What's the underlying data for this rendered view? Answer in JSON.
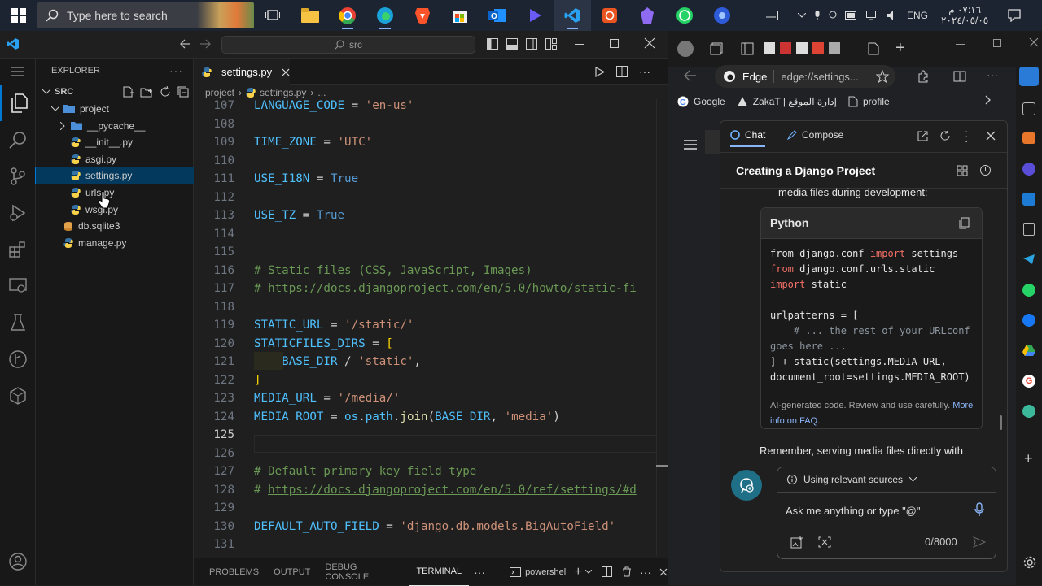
{
  "taskbar": {
    "search_placeholder": "Type here to search",
    "language": "ENG",
    "time": "٠٧:١٦ م",
    "date": "٢٠٢٤/٠٥/٠٥"
  },
  "vscode": {
    "command_center": "src",
    "explorer": {
      "title": "EXPLORER",
      "root": "SRC",
      "items": [
        {
          "label": "project",
          "kind": "folder-open"
        },
        {
          "label": "__pycache__",
          "kind": "folder"
        },
        {
          "label": "__init__.py",
          "kind": "py"
        },
        {
          "label": "asgi.py",
          "kind": "py"
        },
        {
          "label": "settings.py",
          "kind": "py"
        },
        {
          "label": "urls.py",
          "kind": "py"
        },
        {
          "label": "wsgi.py",
          "kind": "py"
        },
        {
          "label": "db.sqlite3",
          "kind": "db"
        },
        {
          "label": "manage.py",
          "kind": "py"
        }
      ]
    },
    "tab": {
      "label": "settings.py"
    },
    "breadcrumb": [
      "project",
      "settings.py",
      "..."
    ],
    "lines": [
      {
        "n": "107",
        "tokens": [
          [
            "v",
            "LANGUAGE_CODE"
          ],
          [
            "o",
            " = "
          ],
          [
            "s",
            "'en-us'"
          ]
        ]
      },
      {
        "n": "108",
        "tokens": []
      },
      {
        "n": "109",
        "tokens": [
          [
            "v",
            "TIME_ZONE"
          ],
          [
            "o",
            " = "
          ],
          [
            "s",
            "'UTC'"
          ]
        ]
      },
      {
        "n": "110",
        "tokens": []
      },
      {
        "n": "111",
        "tokens": [
          [
            "v",
            "USE_I18N"
          ],
          [
            "o",
            " = "
          ],
          [
            "k",
            "True"
          ]
        ]
      },
      {
        "n": "112",
        "tokens": []
      },
      {
        "n": "113",
        "tokens": [
          [
            "v",
            "USE_TZ"
          ],
          [
            "o",
            " = "
          ],
          [
            "k",
            "True"
          ]
        ]
      },
      {
        "n": "114",
        "tokens": []
      },
      {
        "n": "115",
        "tokens": []
      },
      {
        "n": "116",
        "tokens": [
          [
            "c",
            "# Static files (CSS, JavaScript, Images)"
          ]
        ]
      },
      {
        "n": "117",
        "tokens": [
          [
            "c",
            "# "
          ],
          [
            "u",
            "https://docs.djangoproject.com/en/5.0/howto/static-fi"
          ]
        ]
      },
      {
        "n": "118",
        "tokens": []
      },
      {
        "n": "119",
        "tokens": [
          [
            "v",
            "STATIC_URL"
          ],
          [
            "o",
            " = "
          ],
          [
            "s",
            "'/static/'"
          ]
        ]
      },
      {
        "n": "120",
        "tokens": [
          [
            "v",
            "STATICFILES_DIRS"
          ],
          [
            "o",
            " = "
          ],
          [
            "b",
            "["
          ]
        ]
      },
      {
        "n": "121",
        "tokens": [
          [
            "o",
            "    "
          ],
          [
            "v",
            "BASE_DIR"
          ],
          [
            "o",
            " / "
          ],
          [
            "s",
            "'static'"
          ],
          [
            "o",
            ","
          ]
        ]
      },
      {
        "n": "122",
        "tokens": [
          [
            "b",
            "]"
          ]
        ]
      },
      {
        "n": "123",
        "tokens": [
          [
            "v",
            "MEDIA_URL"
          ],
          [
            "o",
            " = "
          ],
          [
            "s",
            "'/media/'"
          ]
        ]
      },
      {
        "n": "124",
        "tokens": [
          [
            "v",
            "MEDIA_ROOT"
          ],
          [
            "o",
            " = "
          ],
          [
            "v",
            "os"
          ],
          [
            "o",
            "."
          ],
          [
            "v",
            "path"
          ],
          [
            "o",
            "."
          ],
          [
            "f",
            "join"
          ],
          [
            "o",
            "("
          ],
          [
            "v",
            "BASE_DIR"
          ],
          [
            "o",
            ", "
          ],
          [
            "s",
            "'media'"
          ],
          [
            "o",
            ")"
          ]
        ]
      },
      {
        "n": "125",
        "tokens": [],
        "current": true
      },
      {
        "n": "126",
        "tokens": []
      },
      {
        "n": "127",
        "tokens": [
          [
            "c",
            "# Default primary key field type"
          ]
        ]
      },
      {
        "n": "128",
        "tokens": [
          [
            "c",
            "# "
          ],
          [
            "u",
            "https://docs.djangoproject.com/en/5.0/ref/settings/#d"
          ]
        ]
      },
      {
        "n": "129",
        "tokens": []
      },
      {
        "n": "130",
        "tokens": [
          [
            "v",
            "DEFAULT_AUTO_FIELD"
          ],
          [
            "o",
            " = "
          ],
          [
            "s",
            "'django.db.models.BigAutoField'"
          ]
        ]
      },
      {
        "n": "131",
        "tokens": []
      }
    ],
    "panel_tabs": [
      "PROBLEMS",
      "OUTPUT",
      "DEBUG CONSOLE",
      "TERMINAL"
    ],
    "terminal_name": "powershell"
  },
  "edge": {
    "brand": "Edge",
    "url": "edge://settings...",
    "bookmarks": [
      "Google",
      "ZakaT | إدارة الموقع",
      "profile"
    ],
    "copilot": {
      "tabs": [
        "Chat",
        "Compose"
      ],
      "title": "Creating a Django Project",
      "pre_text": "media files during development:",
      "code_lang": "Python",
      "code_lines": [
        [
          [
            "t",
            "from django.conf "
          ],
          [
            "k",
            "import"
          ],
          [
            "t",
            " settings"
          ]
        ],
        [
          [
            "k",
            "from"
          ],
          [
            "t",
            " django.conf.urls.static"
          ]
        ],
        [
          [
            "k",
            "import"
          ],
          [
            "t",
            " static"
          ]
        ],
        [
          [
            "t",
            ""
          ]
        ],
        [
          [
            "t",
            "urlpatterns = ["
          ]
        ],
        [
          [
            "c",
            "    # ... the rest of your URLconf"
          ]
        ],
        [
          [
            "c",
            "goes here ..."
          ]
        ],
        [
          [
            "t",
            "] + static(settings.MEDIA_URL,"
          ]
        ],
        [
          [
            "t",
            "document_root=settings.MEDIA_ROOT)"
          ]
        ]
      ],
      "disclaimer": "AI-generated code. Review and use carefully.",
      "faq_link_1": "More",
      "faq_link_2": "info on FAQ",
      "after_text": "Remember, serving media files directly with",
      "sources_label": "Using relevant sources",
      "input_placeholder": "Ask me anything or type \"@\"",
      "char_count": "0/8000"
    }
  }
}
